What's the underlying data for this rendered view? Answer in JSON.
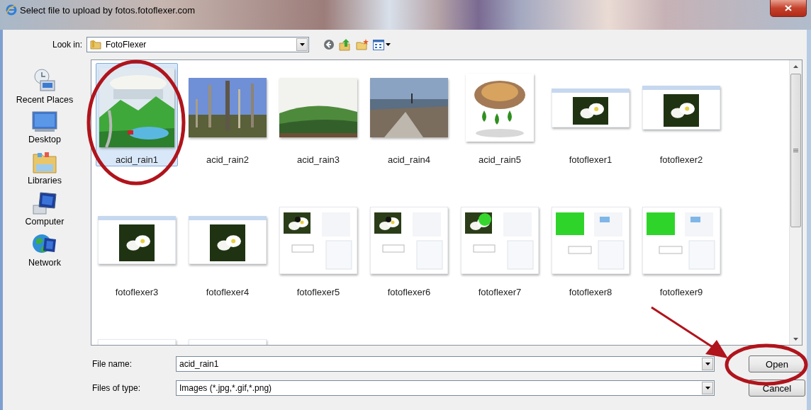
{
  "window": {
    "title": "Select file to upload by fotos.fotoflexer.com"
  },
  "look_in": {
    "label": "Look in:",
    "value": "FotoFlexer"
  },
  "places": [
    {
      "label": "Recent Places",
      "kind": "recent"
    },
    {
      "label": "Desktop",
      "kind": "desktop"
    },
    {
      "label": "Libraries",
      "kind": "libraries"
    },
    {
      "label": "Computer",
      "kind": "computer"
    },
    {
      "label": "Network",
      "kind": "network"
    }
  ],
  "files": [
    {
      "name": "acid_rain1",
      "selected": true
    },
    {
      "name": "acid_rain2",
      "selected": false
    },
    {
      "name": "acid_rain3",
      "selected": false
    },
    {
      "name": "acid_rain4",
      "selected": false
    },
    {
      "name": "acid_rain5",
      "selected": false
    },
    {
      "name": "fotoflexer1",
      "selected": false
    },
    {
      "name": "fotoflexer2",
      "selected": false
    },
    {
      "name": "fotoflexer3",
      "selected": false
    },
    {
      "name": "fotoflexer4",
      "selected": false
    },
    {
      "name": "fotoflexer5",
      "selected": false
    },
    {
      "name": "fotoflexer6",
      "selected": false
    },
    {
      "name": "fotoflexer7",
      "selected": false
    },
    {
      "name": "fotoflexer8",
      "selected": false
    },
    {
      "name": "fotoflexer9",
      "selected": false
    },
    {
      "selected": false
    },
    {
      "selected": false
    }
  ],
  "file_name": {
    "label": "File name:",
    "value": "acid_rain1"
  },
  "file_type": {
    "label": "Files of type:",
    "value": "Images (*.jpg,*.gif,*.png)"
  },
  "buttons": [
    {
      "label": "Open"
    },
    {
      "label": "Cancel"
    }
  ],
  "annotations": [
    {
      "kind": "ellipse"
    },
    {
      "kind": "arrow"
    },
    {
      "kind": "ellipse"
    }
  ]
}
